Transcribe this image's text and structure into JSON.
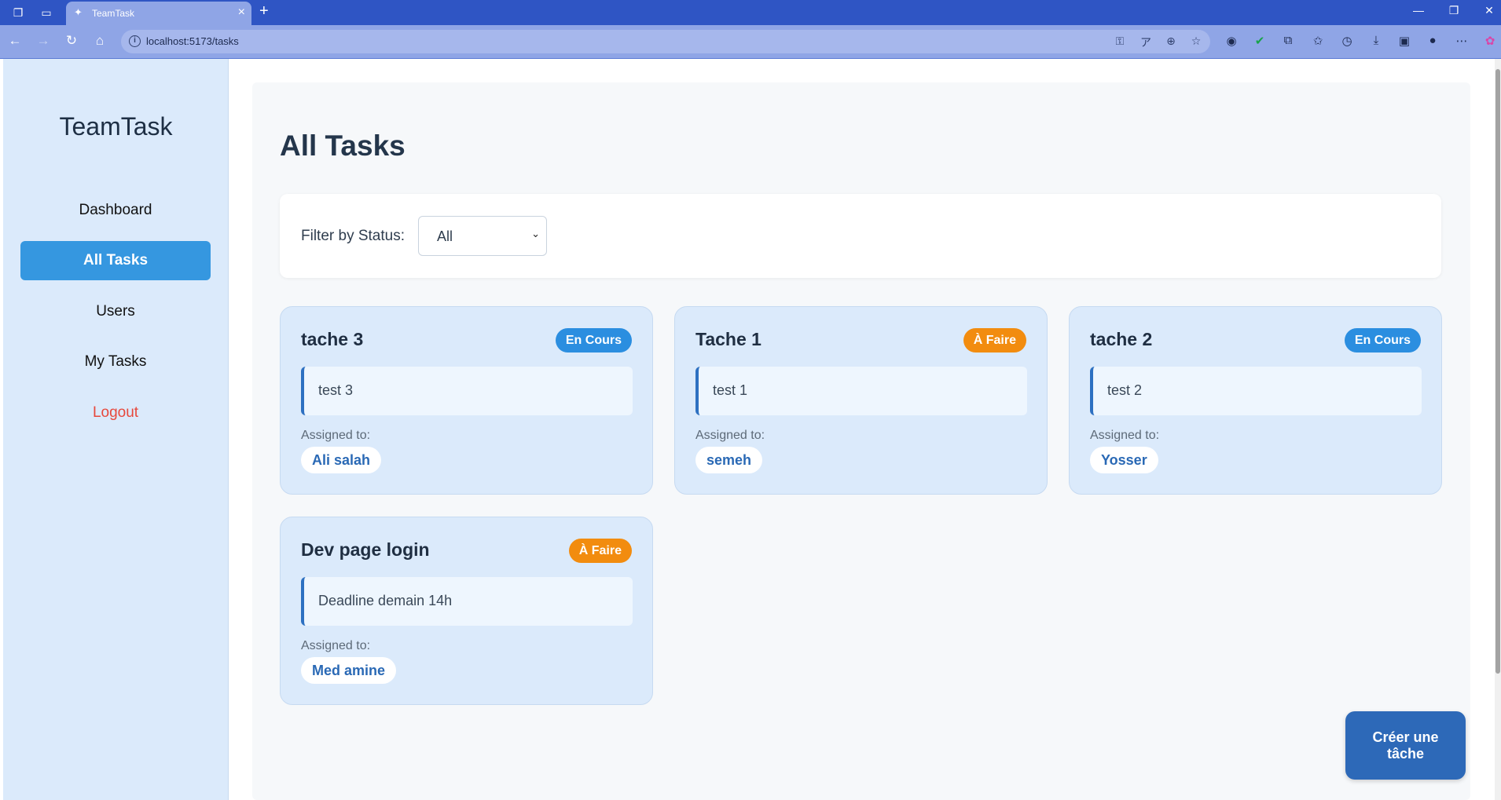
{
  "browser": {
    "tab_title": "TeamTask",
    "url": "localhost:5173/tasks",
    "new_tab_icon": "+",
    "close_tab_icon": "×"
  },
  "sidebar": {
    "brand": "TeamTask",
    "items": [
      {
        "label": "Dashboard"
      },
      {
        "label": "All Tasks"
      },
      {
        "label": "Users"
      },
      {
        "label": "My Tasks"
      },
      {
        "label": "Logout"
      }
    ]
  },
  "main": {
    "title": "All Tasks",
    "filter": {
      "label": "Filter by Status:",
      "selected": "All"
    },
    "assigned_label": "Assigned to:",
    "tasks": [
      {
        "title": "tache 3",
        "status": "En Cours",
        "description": "test 3",
        "assignee": "Ali salah"
      },
      {
        "title": "Tache 1",
        "status": "À Faire",
        "description": "test 1",
        "assignee": "semeh"
      },
      {
        "title": "tache 2",
        "status": "En Cours",
        "description": "test 2",
        "assignee": "Yosser"
      },
      {
        "title": "Dev page login",
        "status": "À Faire",
        "description": "Deadline demain 14h",
        "assignee": "Med amine"
      }
    ],
    "create_button": "Créer une tâche"
  },
  "colors": {
    "status_en_cours": "#2b8ee0",
    "status_a_faire": "#f28c0f",
    "sidebar_active": "#3597e0",
    "logout": "#e7483c"
  }
}
